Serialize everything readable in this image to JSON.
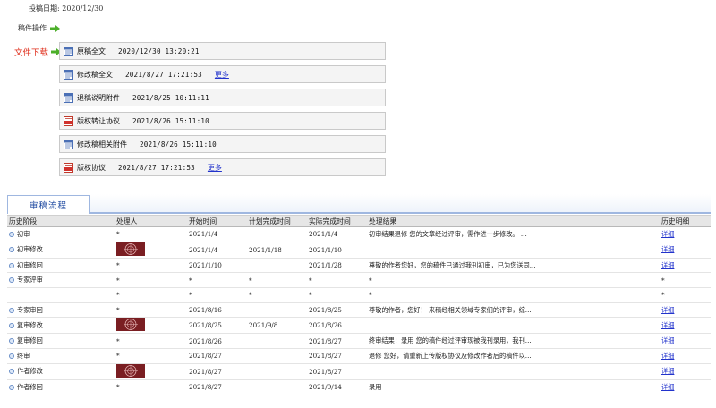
{
  "submit_date": "投稿日期: 2020/12/30",
  "manuscript_ops": {
    "label": "稿件操作"
  },
  "file_download": {
    "label": "文件下载"
  },
  "files": [
    {
      "icon": "word-doc-icon",
      "name": "原稿全文",
      "date": "2020/12/30 13:20:21",
      "more": ""
    },
    {
      "icon": "word-doc-icon",
      "name": "修改稿全文",
      "date": "2021/8/27 17:21:53",
      "more": "更多"
    },
    {
      "icon": "word-doc-icon",
      "name": "退稿说明附件",
      "date": "2021/8/25 10:11:11",
      "more": ""
    },
    {
      "icon": "pdf-icon",
      "name": "版权转让协议",
      "date": "2021/8/26 15:11:10",
      "more": ""
    },
    {
      "icon": "word-doc-icon",
      "name": "修改稿相关附件",
      "date": "2021/8/26 15:11:10",
      "more": ""
    },
    {
      "icon": "pdf-icon",
      "name": "版权协议",
      "date": "2021/8/27 17:21:53",
      "more": "更多"
    }
  ],
  "tab": {
    "label": "审稿流程"
  },
  "table": {
    "headers": [
      "历史阶段",
      "处理人",
      "开始时间",
      "计划完成时间",
      "实际完成时间",
      "处理结果",
      "历史明细"
    ],
    "rows": [
      {
        "stage": "初审",
        "dot": true,
        "handler": "*",
        "avatar": false,
        "start": "2021/1/4",
        "plan": "",
        "actual": "2021/1/4",
        "result": "初审结果退修 您的文章经过评审，需作进一步修改。 ...",
        "result_link": true,
        "detail": "详细",
        "detail_link": true
      },
      {
        "stage": "初审修改",
        "dot": true,
        "handler": "",
        "avatar": true,
        "start": "2021/1/4",
        "plan": "2021/1/18",
        "actual": "2021/1/10",
        "result": "",
        "result_link": false,
        "detail": "详细",
        "detail_link": true
      },
      {
        "stage": "初审修回",
        "dot": true,
        "handler": "*",
        "avatar": false,
        "start": "2021/1/10",
        "plan": "",
        "actual": "2021/1/28",
        "result": "尊敬的作者您好，您的稿件已通过我刊初审，已为您送同...",
        "result_link": true,
        "detail": "详细",
        "detail_link": true
      },
      {
        "stage": "专家评审",
        "dot": true,
        "handler": "*",
        "avatar": false,
        "start": "*",
        "plan": "*",
        "actual": "*",
        "result": "*",
        "result_link": false,
        "detail": "*",
        "detail_link": false
      },
      {
        "stage": "",
        "dot": false,
        "handler": "*",
        "avatar": false,
        "start": "*",
        "plan": "*",
        "actual": "*",
        "result": "*",
        "result_link": false,
        "detail": "*",
        "detail_link": false
      },
      {
        "stage": "专家审回",
        "dot": true,
        "handler": "*",
        "avatar": false,
        "start": "2021/8/16",
        "plan": "",
        "actual": "2021/8/25",
        "result": "尊敬的作者，您好！ 来稿经相关领域专家们的评审，综...",
        "result_link": true,
        "detail": "详细",
        "detail_link": true
      },
      {
        "stage": "复审修改",
        "dot": true,
        "handler": "",
        "avatar": true,
        "start": "2021/8/25",
        "plan": "2021/9/8",
        "actual": "2021/8/26",
        "result": "",
        "result_link": false,
        "detail": "详细",
        "detail_link": true
      },
      {
        "stage": "复审修回",
        "dot": true,
        "handler": "*",
        "avatar": false,
        "start": "2021/8/26",
        "plan": "",
        "actual": "2021/8/27",
        "result": "终审结果：录用 您的稿件经过评审现被我刊录用，我刊...",
        "result_link": true,
        "detail": "详细",
        "detail_link": true
      },
      {
        "stage": "终审",
        "dot": true,
        "handler": "*",
        "avatar": false,
        "start": "2021/8/27",
        "plan": "",
        "actual": "2021/8/27",
        "result": "退修 您好，请重新上传版权协议及修改作者后的稿件以...",
        "result_link": true,
        "detail": "详细",
        "detail_link": true
      },
      {
        "stage": "作者修改",
        "dot": true,
        "handler": "",
        "avatar": true,
        "start": "2021/8/27",
        "plan": "",
        "actual": "2021/8/27",
        "result": "",
        "result_link": false,
        "detail": "详细",
        "detail_link": true
      },
      {
        "stage": "作者修回",
        "dot": true,
        "handler": "*",
        "avatar": false,
        "start": "2021/8/27",
        "plan": "",
        "actual": "2021/9/14",
        "result": "录用",
        "result_link": false,
        "detail": "详细",
        "detail_link": true
      }
    ]
  },
  "colors": {
    "accent_red": "#e0301e",
    "link_blue": "#1f5bbf",
    "tab_border": "#9fb7e0",
    "arrow_green": "#4caf2a"
  }
}
